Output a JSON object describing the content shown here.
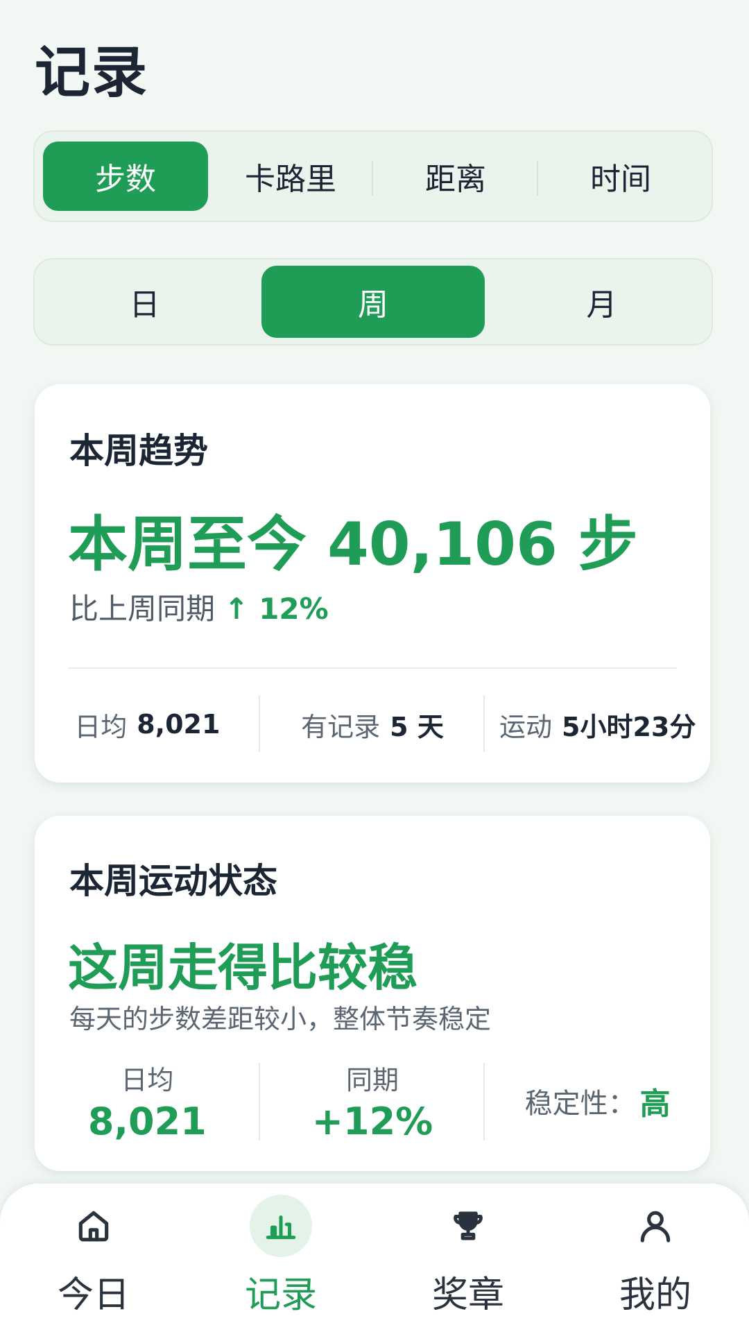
{
  "header": {
    "title": "记录"
  },
  "metric_tabs": [
    {
      "label": "步数",
      "active": true
    },
    {
      "label": "卡路里",
      "active": false
    },
    {
      "label": "距离",
      "active": false
    },
    {
      "label": "时间",
      "active": false
    }
  ],
  "period_tabs": [
    {
      "label": "日",
      "active": false
    },
    {
      "label": "周",
      "active": true
    },
    {
      "label": "月",
      "active": false
    }
  ],
  "trend_card": {
    "title": "本周趋势",
    "headline": "本周至今 40,106 步",
    "compare_label": "比上周同期",
    "compare_value": "↑ 12%",
    "stats": [
      {
        "label": "日均",
        "value": "8,021"
      },
      {
        "label": "有记录",
        "value": "5 天"
      },
      {
        "label": "运动",
        "value": "5小时23分"
      }
    ]
  },
  "status_card": {
    "title": "本周运动状态",
    "headline": "这周走得比较稳",
    "description": "每天的步数差距较小，整体节奏稳定",
    "stats": [
      {
        "label": "日均",
        "value": "8,021"
      },
      {
        "label": "同期",
        "value": "+12%"
      },
      {
        "label": "稳定性：",
        "value": "高"
      }
    ]
  },
  "bottom_nav": [
    {
      "label": "今日",
      "icon": "home-icon",
      "active": false
    },
    {
      "label": "记录",
      "icon": "chart-icon",
      "active": true
    },
    {
      "label": "奖章",
      "icon": "trophy-icon",
      "active": false
    },
    {
      "label": "我的",
      "icon": "user-icon",
      "active": false
    }
  ],
  "colors": {
    "accent": "#1f9d57",
    "background": "#f2f7f3",
    "text": "#1b2533"
  }
}
